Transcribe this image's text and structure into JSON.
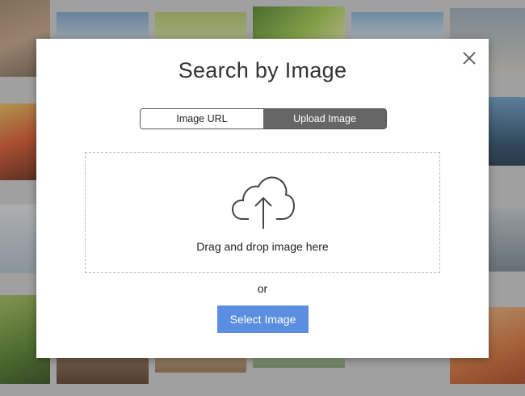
{
  "modal": {
    "title": "Search by Image",
    "close_icon": "close-icon",
    "tabs": [
      {
        "label": "Image URL",
        "active": false
      },
      {
        "label": "Upload Image",
        "active": true
      }
    ],
    "dropzone": {
      "icon": "cloud-upload-icon",
      "text": "Drag and drop image here"
    },
    "separator_text": "or",
    "select_button_label": "Select Image"
  },
  "colors": {
    "accent_button": "#5b8ee0",
    "active_tab": "#666666",
    "overlay": "#3c3c3c"
  }
}
